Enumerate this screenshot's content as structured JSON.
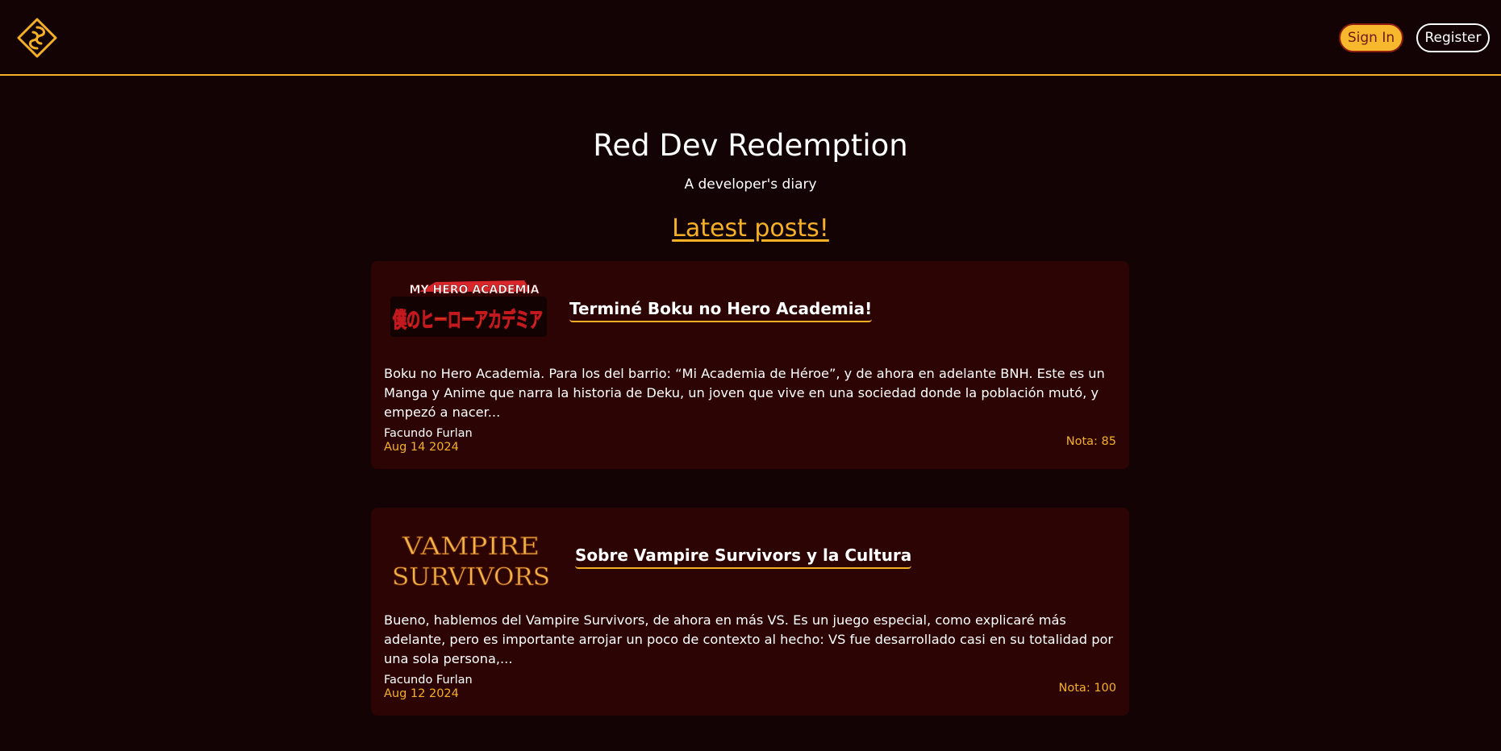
{
  "header": {
    "logo_icon": "puzzle-diamond-icon",
    "signin_label": "Sign In",
    "register_label": "Register",
    "accent_color": "#f5b025"
  },
  "hero": {
    "title": "Red Dev Redemption",
    "subtitle": "A developer's diary",
    "latest_posts_label": "Latest posts!"
  },
  "posts": [
    {
      "image_text": [
        "MY HERO ACADEMIA",
        "僕のヒーローアカデミア"
      ],
      "title": "Terminé Boku no Hero Academia!",
      "excerpt": "Boku no Hero Academia. Para los del barrio: “Mi Academia de Héroe”, y de ahora en adelante BNH. Este es un Manga y Anime que narra la historia de Deku, un joven que vive en una sociedad donde la población mutó, y empezó a nacer...",
      "author": "Facundo Furlan",
      "date": "Aug 14 2024",
      "score": "Nota: 85"
    },
    {
      "image_text": [
        "VAMPIRE",
        "SURVIVORS"
      ],
      "title": "Sobre Vampire Survivors y la Cultura",
      "excerpt": "Bueno, hablemos del Vampire Survivors, de ahora en más VS. Es un juego especial, como explicaré más adelante, pero es importante arrojar un poco de contexto al hecho: VS fue desarrollado casi en su totalidad por una sola persona,...",
      "author": "Facundo Furlan",
      "date": "Aug 12 2024",
      "score": "Nota: 100"
    }
  ]
}
